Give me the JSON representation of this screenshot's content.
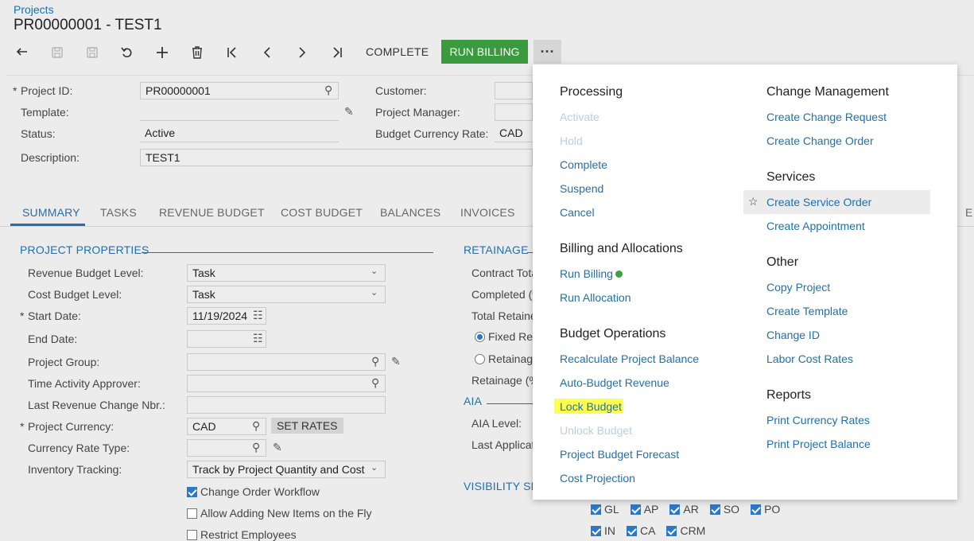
{
  "header": {
    "breadcrumb": "Projects",
    "title": "PR00000001 - TEST1"
  },
  "toolbar": {
    "complete_label": "COMPLETE",
    "run_billing_label": "RUN BILLING",
    "more_label": "···"
  },
  "form": {
    "project_id": {
      "label": "Project ID:",
      "value": "PR00000001"
    },
    "template": {
      "label": "Template:",
      "value": ""
    },
    "status": {
      "label": "Status:",
      "value": "Active"
    },
    "description": {
      "label": "Description:",
      "value": "TEST1"
    },
    "customer": {
      "label": "Customer:"
    },
    "project_manager": {
      "label": "Project Manager:"
    },
    "budget_currency_rate": {
      "label": "Budget Currency Rate:",
      "value": "CAD"
    }
  },
  "tabs": [
    "SUMMARY",
    "TASKS",
    "REVENUE BUDGET",
    "COST BUDGET",
    "BALANCES",
    "INVOICES",
    "E"
  ],
  "summary": {
    "project_properties": {
      "title": "PROJECT PROPERTIES",
      "revenue_budget_level": {
        "label": "Revenue Budget Level:",
        "value": "Task"
      },
      "cost_budget_level": {
        "label": "Cost Budget Level:",
        "value": "Task"
      },
      "start_date": {
        "label": "Start Date:",
        "value": "11/19/2024"
      },
      "end_date": {
        "label": "End Date:",
        "value": ""
      },
      "project_group": {
        "label": "Project Group:"
      },
      "time_activity_approver": {
        "label": "Time Activity Approver:"
      },
      "last_revenue_change_nbr": {
        "label": "Last Revenue Change Nbr.:"
      },
      "project_currency": {
        "label": "Project Currency:",
        "value": "CAD"
      },
      "set_rates_label": "SET RATES",
      "currency_rate_type": {
        "label": "Currency Rate Type:"
      },
      "inventory_tracking": {
        "label": "Inventory Tracking:",
        "value": "Track by Project Quantity and Cost"
      },
      "change_order_workflow": {
        "label": "Change Order Workflow",
        "checked": true
      },
      "allow_adding_new_items": {
        "label": "Allow Adding New Items on the Fly",
        "checked": false
      },
      "restrict_employees": {
        "label": "Restrict Employees",
        "checked": false
      }
    },
    "retainage": {
      "title": "RETAINAGE",
      "contract_total": "Contract Tota",
      "completed": "Completed (%",
      "total_retained": "Total Retaine",
      "fixed_ret": "Fixed Ret",
      "retainage_opt": "Retainage",
      "retainage_pct": "Retainage (%"
    },
    "aia": {
      "title": "AIA",
      "aia_level": "AIA Level:",
      "last_application": "Last Applicati"
    },
    "visibility": {
      "title": "VISIBILITY SE",
      "row1": [
        "GL",
        "AP",
        "AR",
        "SO",
        "PO"
      ],
      "row2": [
        "IN",
        "CA",
        "CRM"
      ]
    }
  },
  "menu": {
    "processing": {
      "heading": "Processing",
      "items": [
        "Activate",
        "Hold",
        "Complete",
        "Suspend",
        "Cancel"
      ]
    },
    "billing": {
      "heading": "Billing and Allocations",
      "items": [
        "Run Billing",
        "Run Allocation"
      ]
    },
    "budget_ops": {
      "heading": "Budget Operations",
      "items": [
        "Recalculate Project Balance",
        "Auto-Budget Revenue",
        "Lock Budget",
        "Unlock Budget",
        "Project Budget Forecast",
        "Cost Projection"
      ]
    },
    "change_mgmt": {
      "heading": "Change Management",
      "items": [
        "Create Change Request",
        "Create Change Order"
      ]
    },
    "services": {
      "heading": "Services",
      "items": [
        "Create Service Order",
        "Create Appointment"
      ]
    },
    "other": {
      "heading": "Other",
      "items": [
        "Copy Project",
        "Create Template",
        "Change ID",
        "Labor Cost Rates"
      ]
    },
    "reports": {
      "heading": "Reports",
      "items": [
        "Print Currency Rates",
        "Print Project Balance"
      ]
    }
  }
}
